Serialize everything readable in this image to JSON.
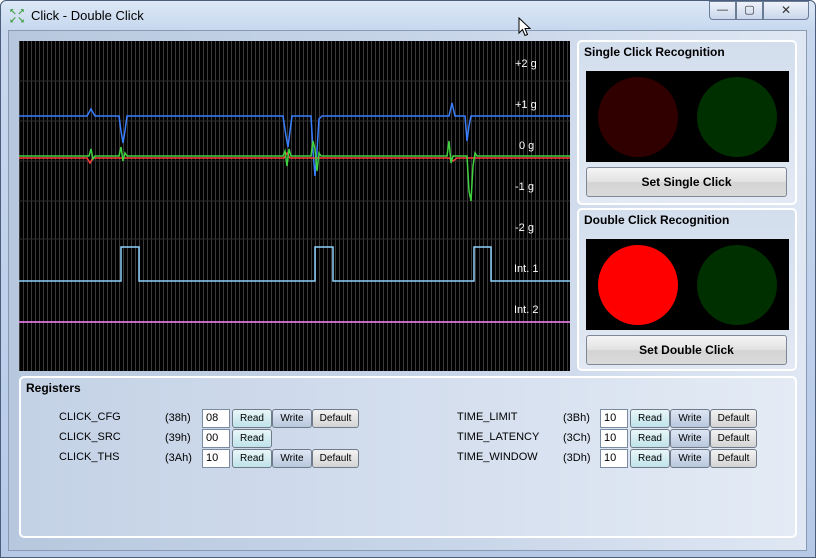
{
  "window": {
    "title": "Click - Double Click",
    "icon": "app-grid-icon",
    "controls": {
      "minimize": "—",
      "maximize": "▢",
      "close": "✕"
    }
  },
  "scope": {
    "scale_labels": [
      "+2 g",
      "+1 g",
      "0 g",
      "-1 g",
      "-2 g",
      "Int. 1",
      "Int. 2"
    ],
    "colors": {
      "x": "#ff3b3b",
      "y": "#3fd13f",
      "z": "#3b7fff",
      "int1": "#8fd3ff",
      "int2": "#ff88ff",
      "grid": "#3a3a3a"
    }
  },
  "single_click": {
    "title": "Single Click Recognition",
    "button": "Set Single Click",
    "led_left_color": "#300000",
    "led_right_color": "#003000"
  },
  "double_click": {
    "title": "Double Click Recognition",
    "button": "Set Double Click",
    "led_left_color": "#ff0000",
    "led_right_color": "#003000"
  },
  "registers": {
    "title": "Registers",
    "read_label": "Read",
    "write_label": "Write",
    "default_label": "Default",
    "left": [
      {
        "name": "CLICK_CFG",
        "addr": "(38h)",
        "value": "08"
      },
      {
        "name": "CLICK_SRC",
        "addr": "(39h)",
        "value": "00"
      },
      {
        "name": "CLICK_THS",
        "addr": "(3Ah)",
        "value": "10"
      }
    ],
    "right": [
      {
        "name": "TIME_LIMIT",
        "addr": "(3Bh)",
        "value": "10"
      },
      {
        "name": "TIME_LATENCY",
        "addr": "(3Ch)",
        "value": "10"
      },
      {
        "name": "TIME_WINDOW",
        "addr": "(3Dh)",
        "value": "10"
      }
    ]
  }
}
